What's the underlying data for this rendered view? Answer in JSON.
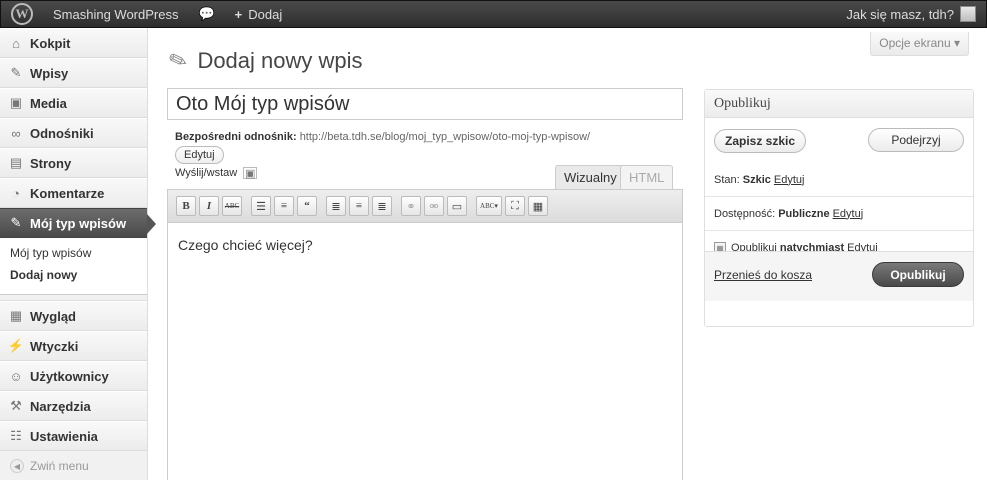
{
  "adminbar": {
    "site_name": "Smashing WordPress",
    "add_label": "Dodaj",
    "greeting": "Jak się masz, tdh?"
  },
  "sidebar": {
    "items": [
      {
        "label": "Kokpit",
        "icon": "dashboard-icon"
      },
      {
        "label": "Wpisy",
        "icon": "pushpin-icon"
      },
      {
        "label": "Media",
        "icon": "media-icon"
      },
      {
        "label": "Odnośniki",
        "icon": "links-icon"
      },
      {
        "label": "Strony",
        "icon": "pages-icon"
      },
      {
        "label": "Komentarze",
        "icon": "comments-icon"
      },
      {
        "label": "Mój typ wpisów",
        "icon": "pushpin-icon"
      }
    ],
    "submenu": [
      "Mój typ wpisów",
      "Dodaj nowy"
    ],
    "items2": [
      {
        "label": "Wygląd",
        "icon": "appearance-icon"
      },
      {
        "label": "Wtyczki",
        "icon": "plugins-icon"
      },
      {
        "label": "Użytkownicy",
        "icon": "users-icon"
      },
      {
        "label": "Narzędzia",
        "icon": "tools-icon"
      },
      {
        "label": "Ustawienia",
        "icon": "settings-icon"
      }
    ],
    "collapse": "Zwiń menu"
  },
  "main": {
    "screen_options": "Opcje ekranu",
    "title": "Dodaj nowy wpis",
    "post_title": "Oto Mój typ wpisów",
    "permalink_label": "Bezpośredni odnośnik:",
    "permalink_url": "http://beta.tdh.se/blog/moj_typ_wpisow/oto-moj-typ-wpisow/",
    "permalink_edit": "Edytuj",
    "upload_label": "Wyślij/wstaw",
    "tab_visual": "Wizualny",
    "tab_html": "HTML",
    "content": "Czego chcieć więcej?"
  },
  "publish": {
    "heading": "Opublikuj",
    "save_draft": "Zapisz szkic",
    "preview": "Podejrzyj",
    "status_label": "Stan:",
    "status_value": "Szkic",
    "visibility_label": "Dostępność:",
    "visibility_value": "Publiczne",
    "schedule_label": "Opublikuj",
    "schedule_value": "natychmiast",
    "edit": "Edytuj",
    "trash": "Przenieś do kosza",
    "publish": "Opublikuj"
  }
}
